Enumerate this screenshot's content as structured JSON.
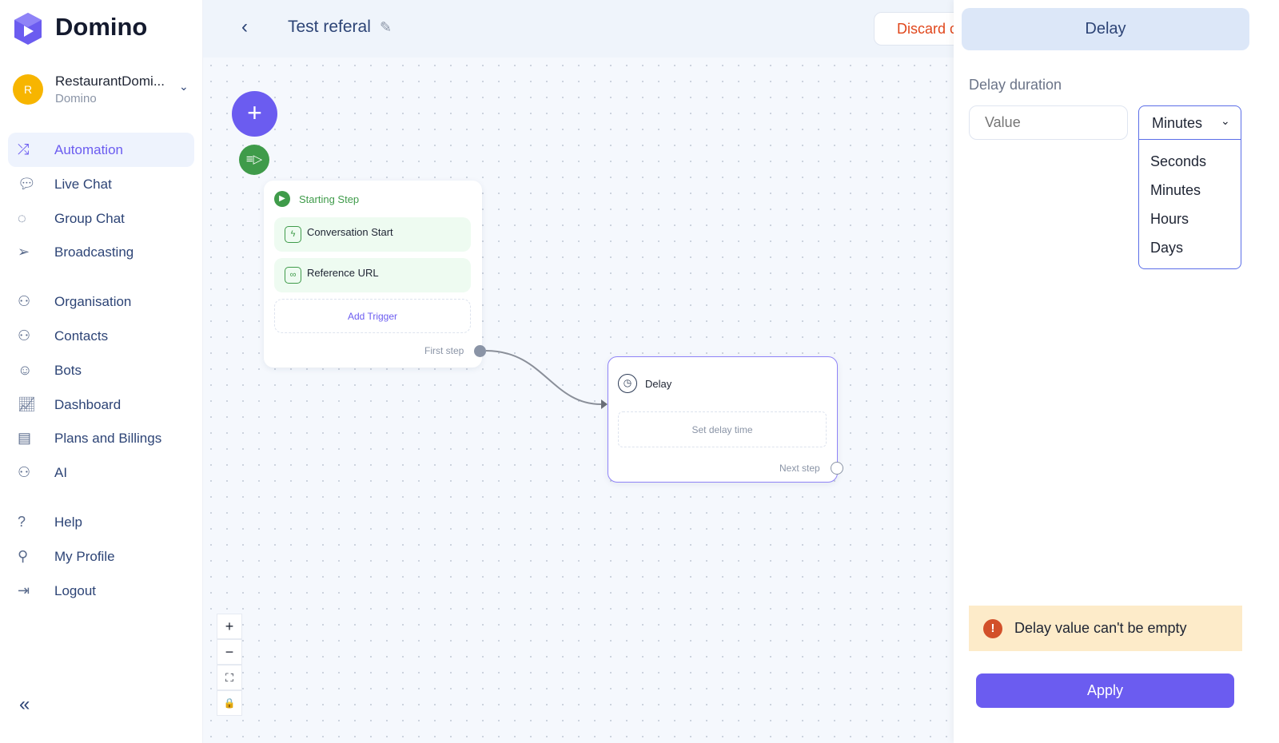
{
  "brand": {
    "name": "Domino",
    "accent": "#6b5cf0"
  },
  "account": {
    "initial": "R",
    "name": "RestaurantDomi...",
    "workspace": "Domino"
  },
  "sidebar": {
    "items": [
      {
        "label": "Automation",
        "icon": "shuffle-icon",
        "active": true
      },
      {
        "label": "Live Chat",
        "icon": "chat-icon"
      },
      {
        "label": "Group Chat",
        "icon": "group-chat-icon"
      },
      {
        "label": "Broadcasting",
        "icon": "send-icon"
      },
      {
        "label": "Organisation",
        "icon": "organisation-icon"
      },
      {
        "label": "Contacts",
        "icon": "contacts-icon"
      },
      {
        "label": "Bots",
        "icon": "bot-icon"
      },
      {
        "label": "Dashboard",
        "icon": "chart-icon"
      },
      {
        "label": "Plans and Billings",
        "icon": "billing-icon"
      },
      {
        "label": "AI",
        "icon": "ai-icon"
      },
      {
        "label": "Help",
        "icon": "help-icon"
      },
      {
        "label": "My Profile",
        "icon": "profile-icon"
      },
      {
        "label": "Logout",
        "icon": "logout-icon"
      }
    ],
    "collapse": "«"
  },
  "header": {
    "title": "Test referal",
    "discard": "Discard c"
  },
  "flow": {
    "start": {
      "title": "Starting Step",
      "triggers": [
        "Conversation Start",
        "Reference URL"
      ],
      "add_trigger": "Add Trigger",
      "next": "First step"
    },
    "delay": {
      "title": "Delay",
      "placeholder": "Set delay time",
      "next": "Next step"
    }
  },
  "panel": {
    "title": "Delay",
    "label": "Delay duration",
    "value_placeholder": "Value",
    "unit": "Minutes",
    "options": [
      "Seconds",
      "Minutes",
      "Hours",
      "Days"
    ],
    "error": "Delay value can't be empty",
    "apply": "Apply"
  },
  "zoom_controls": {
    "in": "+",
    "out": "−",
    "fit": "⛶",
    "lock": "🔒"
  }
}
